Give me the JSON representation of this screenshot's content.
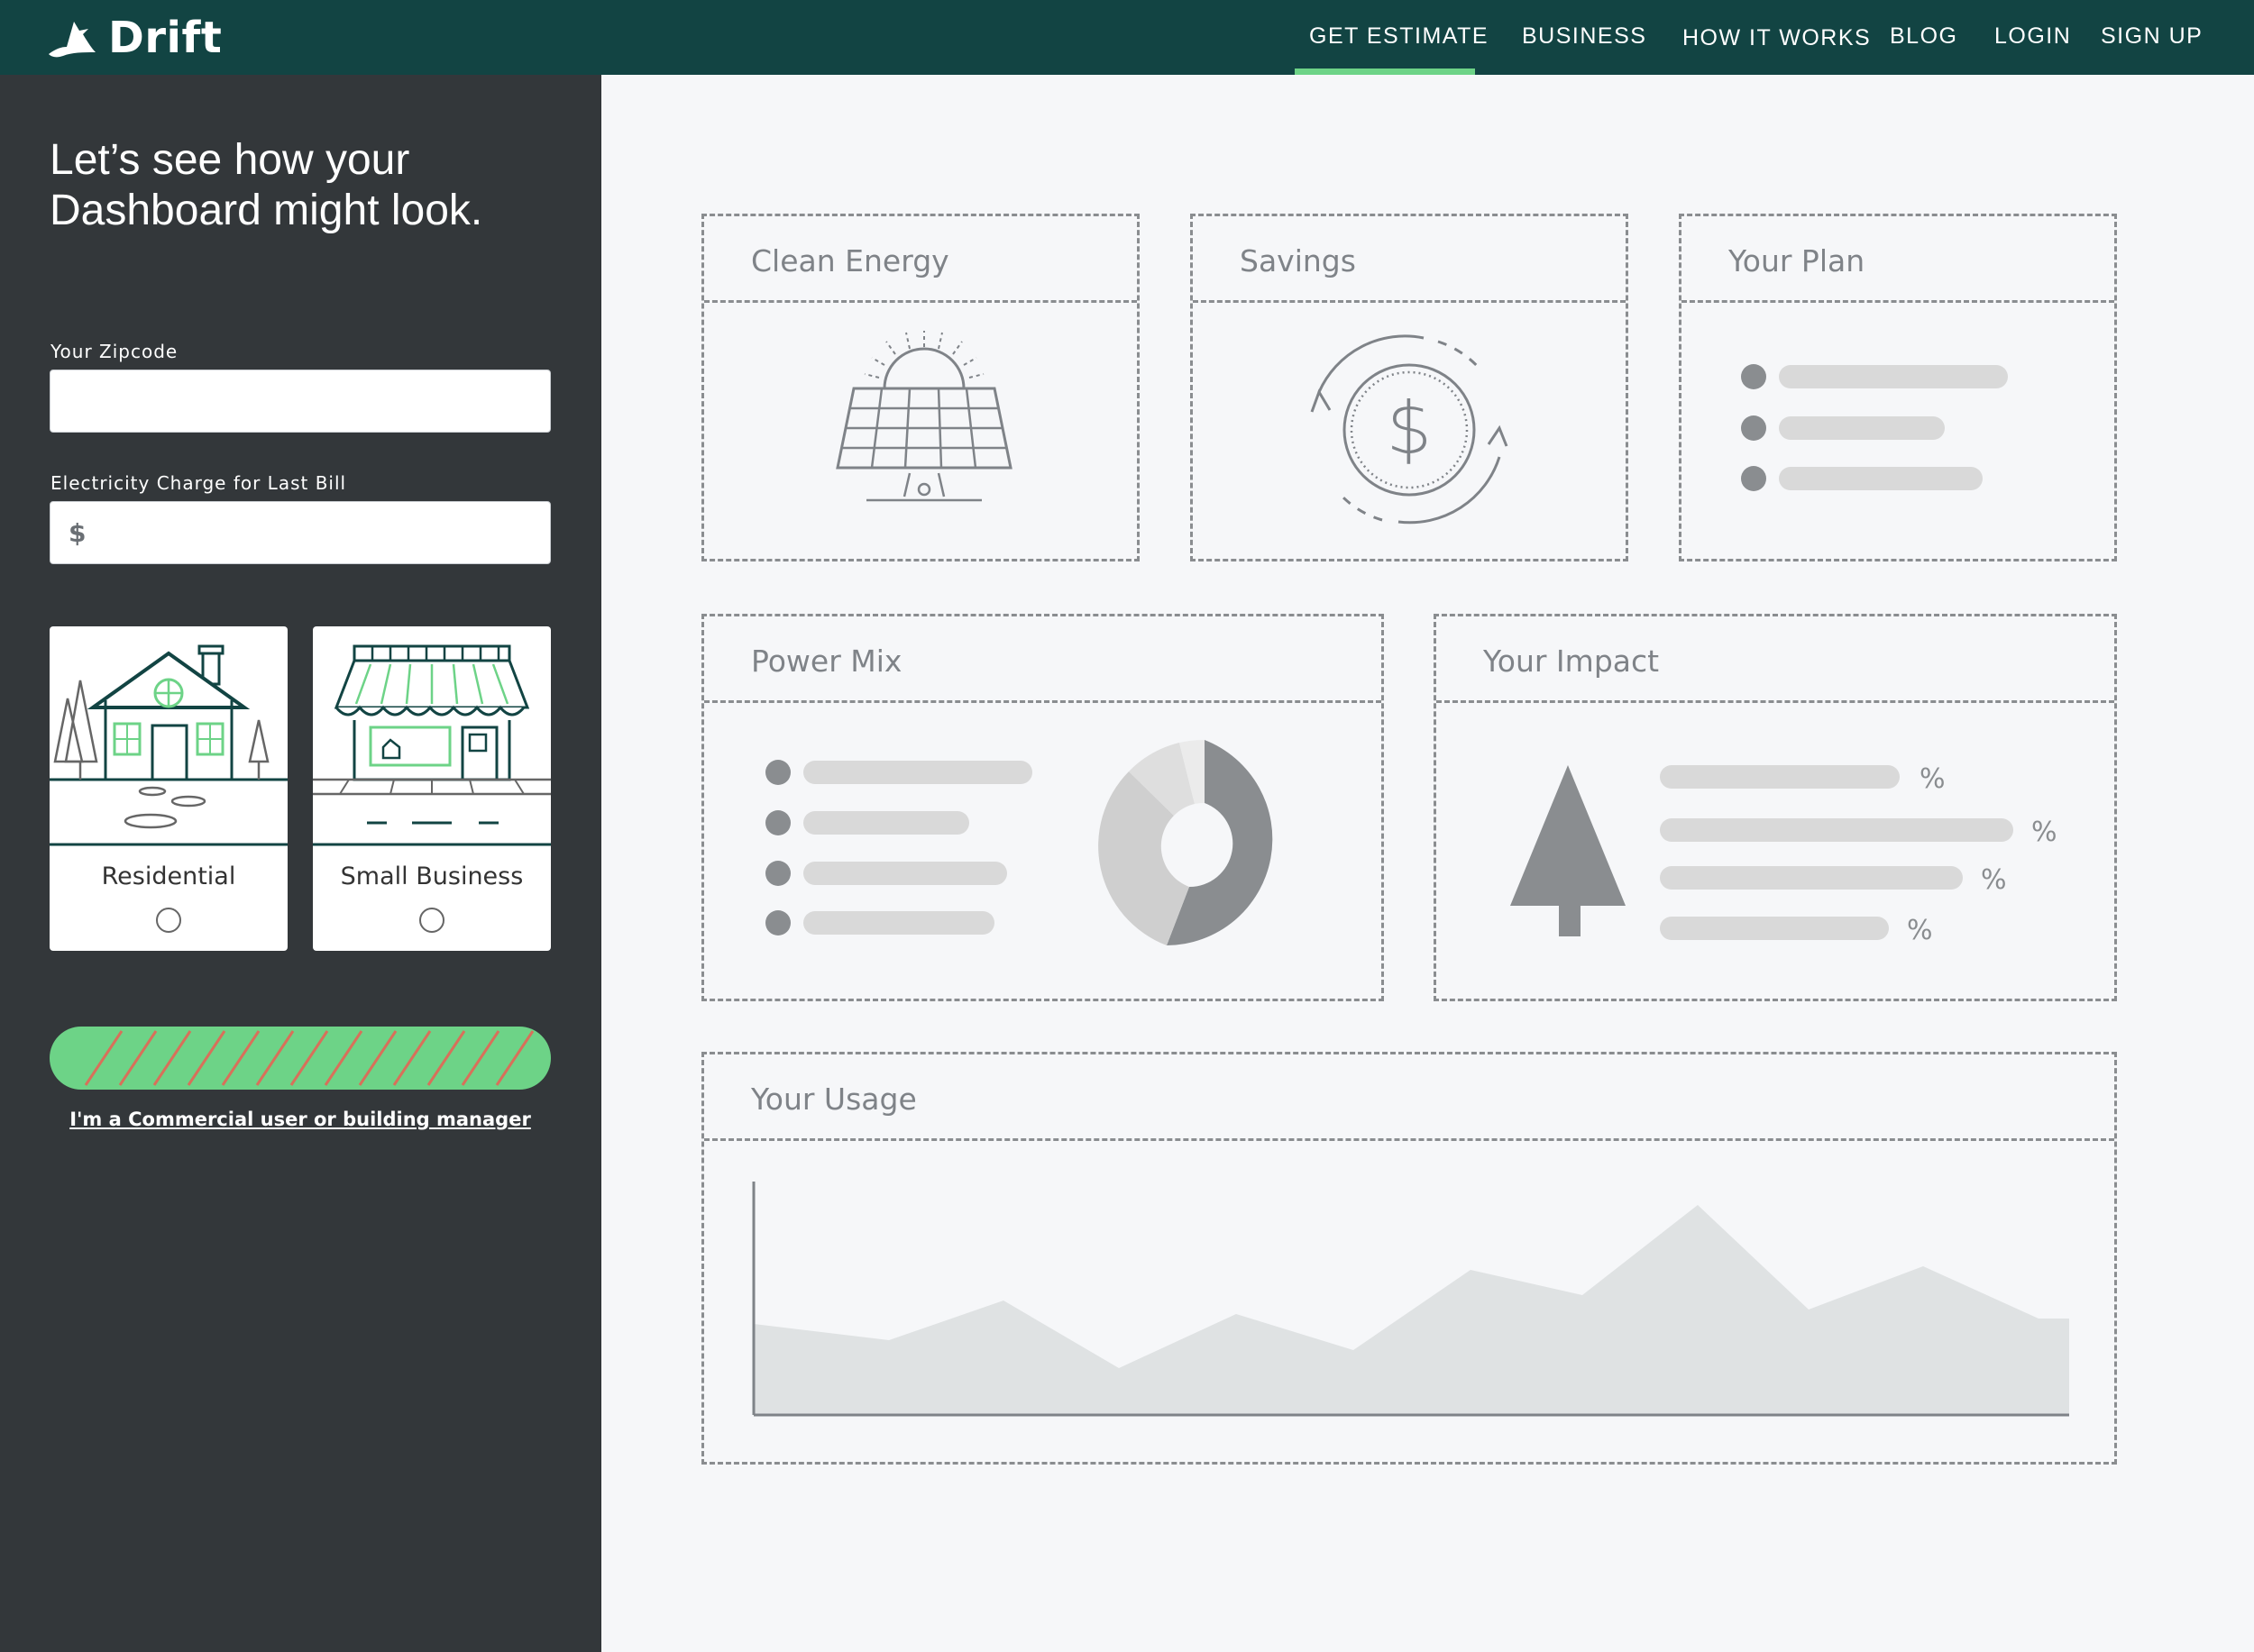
{
  "brand": {
    "name": "Drift",
    "header_color": "#124443",
    "accent": "#6dd387"
  },
  "nav": {
    "items": [
      "GET ESTIMATE",
      "BUSINESS",
      "HOW IT WORKS",
      "BLOG",
      "LOGIN",
      "SIGN UP"
    ],
    "active": "GET ESTIMATE"
  },
  "sidebar": {
    "heading": "Let’s see how your Dashboard might look.",
    "zipcode": {
      "label": "Your Zipcode",
      "value": ""
    },
    "bill": {
      "label": "Electricity Charge for Last Bill",
      "prefix": "$",
      "value": ""
    },
    "types": [
      {
        "label": "Residential",
        "icon": "house-icon",
        "selected": false
      },
      {
        "label": "Small Business",
        "icon": "storefront-icon",
        "selected": false
      }
    ],
    "commercial_link": "I'm a Commercial user or building manager"
  },
  "panels": {
    "clean_energy": {
      "title": "Clean Energy",
      "icon": "solar-panel-icon"
    },
    "savings": {
      "title": "Savings",
      "icon": "dollar-cycle-icon"
    },
    "plan": {
      "title": "Your Plan"
    },
    "power_mix": {
      "title": "Power Mix"
    },
    "impact": {
      "title": "Your Impact",
      "icon": "tree-icon",
      "unit": "%"
    },
    "usage": {
      "title": "Your Usage"
    }
  }
}
